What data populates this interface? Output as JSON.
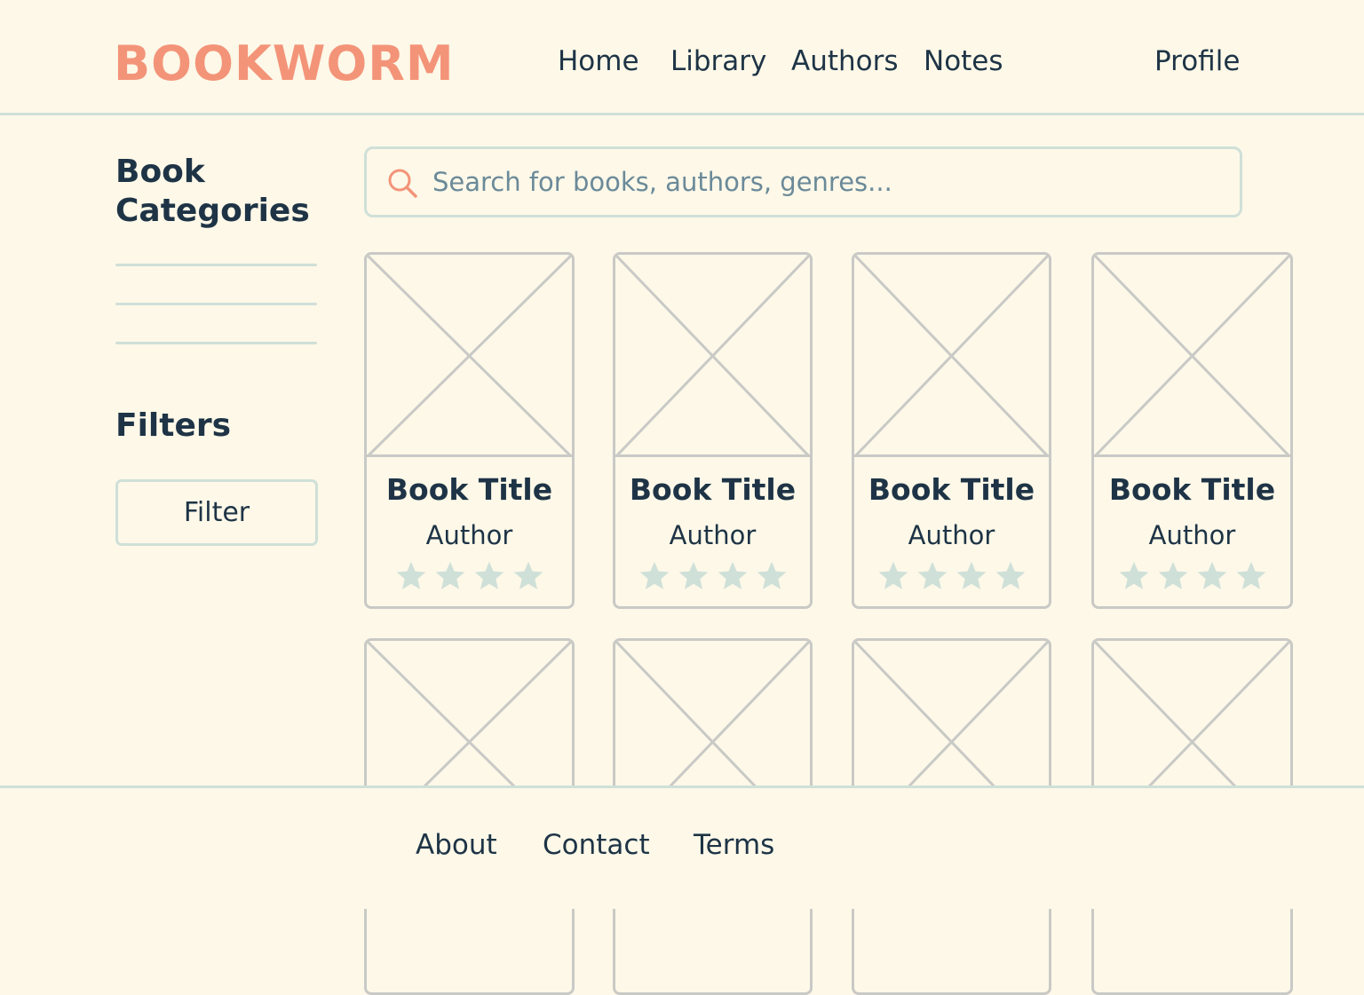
{
  "brand": {
    "logo": "BOOKWORM"
  },
  "nav": {
    "home": "Home",
    "library": "Library",
    "authors": "Authors",
    "notes": "Notes",
    "profile": "Profile"
  },
  "sidebar": {
    "categories_heading": "Book Categories",
    "filters_heading": "Filters",
    "filter_button": "Filter"
  },
  "search": {
    "placeholder": "Search for books, authors, genres...",
    "value": ""
  },
  "books": [
    {
      "title": "Book Title",
      "author": "Author",
      "rating": 4
    },
    {
      "title": "Book Title",
      "author": "Author",
      "rating": 4
    },
    {
      "title": "Book Title",
      "author": "Author",
      "rating": 4
    },
    {
      "title": "Book Title",
      "author": "Author",
      "rating": 4
    },
    {
      "title": "",
      "author": "",
      "rating": null
    },
    {
      "title": "",
      "author": "",
      "rating": null
    },
    {
      "title": "",
      "author": "",
      "rating": null
    },
    {
      "title": "",
      "author": "",
      "rating": null
    }
  ],
  "footer": {
    "about": "About",
    "contact": "Contact",
    "terms": "Terms"
  },
  "colors": {
    "background": "#fdf8e8",
    "brand": "#f39479",
    "text": "#1e3446",
    "divider": "#cfe0d8",
    "star": "#cfe0d8",
    "placeholder_stroke": "#c9c9c6"
  },
  "icons": {
    "search": "search-icon",
    "star": "star-icon",
    "cover": "image-placeholder-icon"
  }
}
